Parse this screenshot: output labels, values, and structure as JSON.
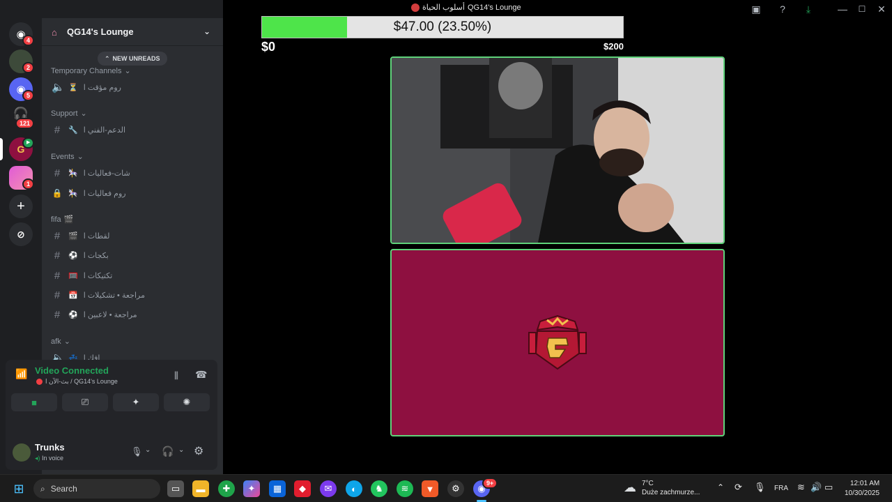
{
  "window": {
    "title": "QG14's Lounge",
    "title_prefix": "أسلوب الحياة"
  },
  "rail": {
    "servers": [
      {
        "name": "discord-home",
        "badge": "4"
      },
      {
        "name": "dm-user",
        "badge": "2"
      },
      {
        "name": "discord-server",
        "badge": "5"
      },
      {
        "name": "headset-server",
        "badge": "121"
      },
      {
        "name": "qg14-server",
        "badge": ""
      },
      {
        "name": "pink-server",
        "badge": "1"
      }
    ]
  },
  "sidebar": {
    "guild_name": "QG14's Lounge",
    "new_unreads": "NEW UNREADS",
    "categories": [
      {
        "label": "Temporary Channels",
        "channels": [
          {
            "type": "voice",
            "emoji": "⏳",
            "name": "روم مؤقت ا"
          }
        ]
      },
      {
        "label": "Support",
        "channels": [
          {
            "type": "text",
            "emoji": "🔧",
            "name": "الدعم-الفني ا"
          }
        ]
      },
      {
        "label": "Events",
        "channels": [
          {
            "type": "text",
            "emoji": "🎠",
            "name": "شات-فعاليات ا"
          },
          {
            "type": "locked",
            "emoji": "🎠",
            "name": "روم فعاليات ا"
          }
        ]
      },
      {
        "label": "fifa",
        "channels": [
          {
            "type": "text",
            "emoji": "🎬",
            "name": "لقطات ا"
          },
          {
            "type": "text",
            "emoji": "⚽",
            "name": "بكجات ا"
          },
          {
            "type": "text",
            "emoji": "🥅",
            "name": "تكتيكات ا"
          },
          {
            "type": "text",
            "emoji": "📅",
            "name": "مراجعة • تشكيلات ا"
          },
          {
            "type": "text",
            "emoji": "⚽",
            "name": "مراجعة • لاعبين ا"
          }
        ]
      },
      {
        "label": "afk",
        "channels": [
          {
            "type": "voice",
            "emoji": "💤",
            "name": "افك ا"
          }
        ]
      }
    ]
  },
  "voice": {
    "status": "Video Connected",
    "channel": "بث-الآن ا / QG14's Lounge"
  },
  "user": {
    "name": "Trunks",
    "status": "In voice"
  },
  "goal": {
    "text": "$47.00 (23.50%)",
    "min": "$0",
    "max": "$200",
    "progress": 0.235
  },
  "taskbar": {
    "search_placeholder": "Search",
    "weather_temp": "7°C",
    "weather_desc": "Duże zachmurze...",
    "language": "FRA",
    "time": "12:01 AM",
    "date": "10/30/2025",
    "discord_badge": "9+"
  },
  "colors": {
    "accent_green": "#23a55a",
    "goal_fill": "#4ee44a",
    "share_bg": "#8e1040",
    "badge_red": "#f23f43"
  }
}
